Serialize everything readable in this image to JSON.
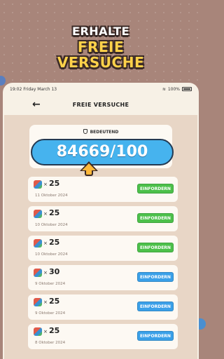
{
  "headline": {
    "line1": "ERHALTE",
    "line2": "FREIE",
    "line3": "VERSUCHE"
  },
  "status_bar": {
    "time_date": "19:02  Friday March 13",
    "battery": "100%"
  },
  "nav": {
    "title": "FREIE VERSUCHE"
  },
  "summary": {
    "label": "BEDEUTEND",
    "counter": "84669/100"
  },
  "rows": [
    {
      "times": "×",
      "amount": "25",
      "date": "11 Oktober 2024",
      "button": "EINFORDERN",
      "button_color": "#4cc04a"
    },
    {
      "times": "×",
      "amount": "25",
      "date": "10 Oktober 2024",
      "button": "EINFORDERN",
      "button_color": "#4cc04a"
    },
    {
      "times": "×",
      "amount": "25",
      "date": "10 Oktober 2024",
      "button": "EINFORDERN",
      "button_color": "#4cc04a"
    },
    {
      "times": "×",
      "amount": "30",
      "date": "9 Oktober 2024",
      "button": "EINFORDERN",
      "button_color": "#3aa0e8"
    },
    {
      "times": "×",
      "amount": "25",
      "date": "9 Oktober 2024",
      "button": "EINFORDERN",
      "button_color": "#3aa0e8"
    },
    {
      "times": "×",
      "amount": "25",
      "date": "8 Oktober 2024",
      "button": "EINFORDERN",
      "button_color": "#3aa0e8"
    }
  ],
  "colors": {
    "background": "#a8857a",
    "counter_fill": "#46b3ee",
    "headline_yellow": "#ffd24a"
  }
}
